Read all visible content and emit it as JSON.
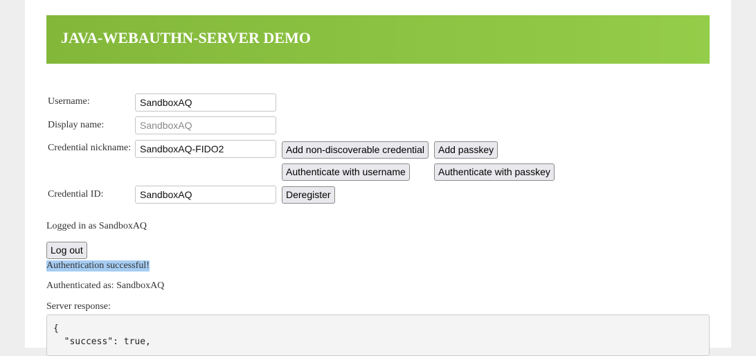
{
  "header": {
    "title": "JAVA-WEBAUTHN-SERVER DEMO"
  },
  "form": {
    "username_label": "Username:",
    "username_value": "SandboxAQ",
    "display_name_label": "Display name:",
    "display_name_placeholder": "SandboxAQ",
    "nickname_label": "Credential nickname:",
    "nickname_value": "SandboxAQ-FIDO2",
    "credential_id_label": "Credential ID:",
    "credential_id_value": "SandboxAQ"
  },
  "buttons": {
    "add_non_discoverable": "Add non-discoverable credential",
    "add_passkey": "Add passkey",
    "auth_username": "Authenticate with username",
    "auth_passkey": "Authenticate with passkey",
    "deregister": "Deregister",
    "logout": "Log out"
  },
  "status": {
    "logged_in": "Logged in as SandboxAQ",
    "message": "Authentication successful!",
    "authenticated_as": "Authenticated as: SandboxAQ",
    "server_response_label": "Server response:",
    "server_response": "{\n  \"success\": true,"
  }
}
